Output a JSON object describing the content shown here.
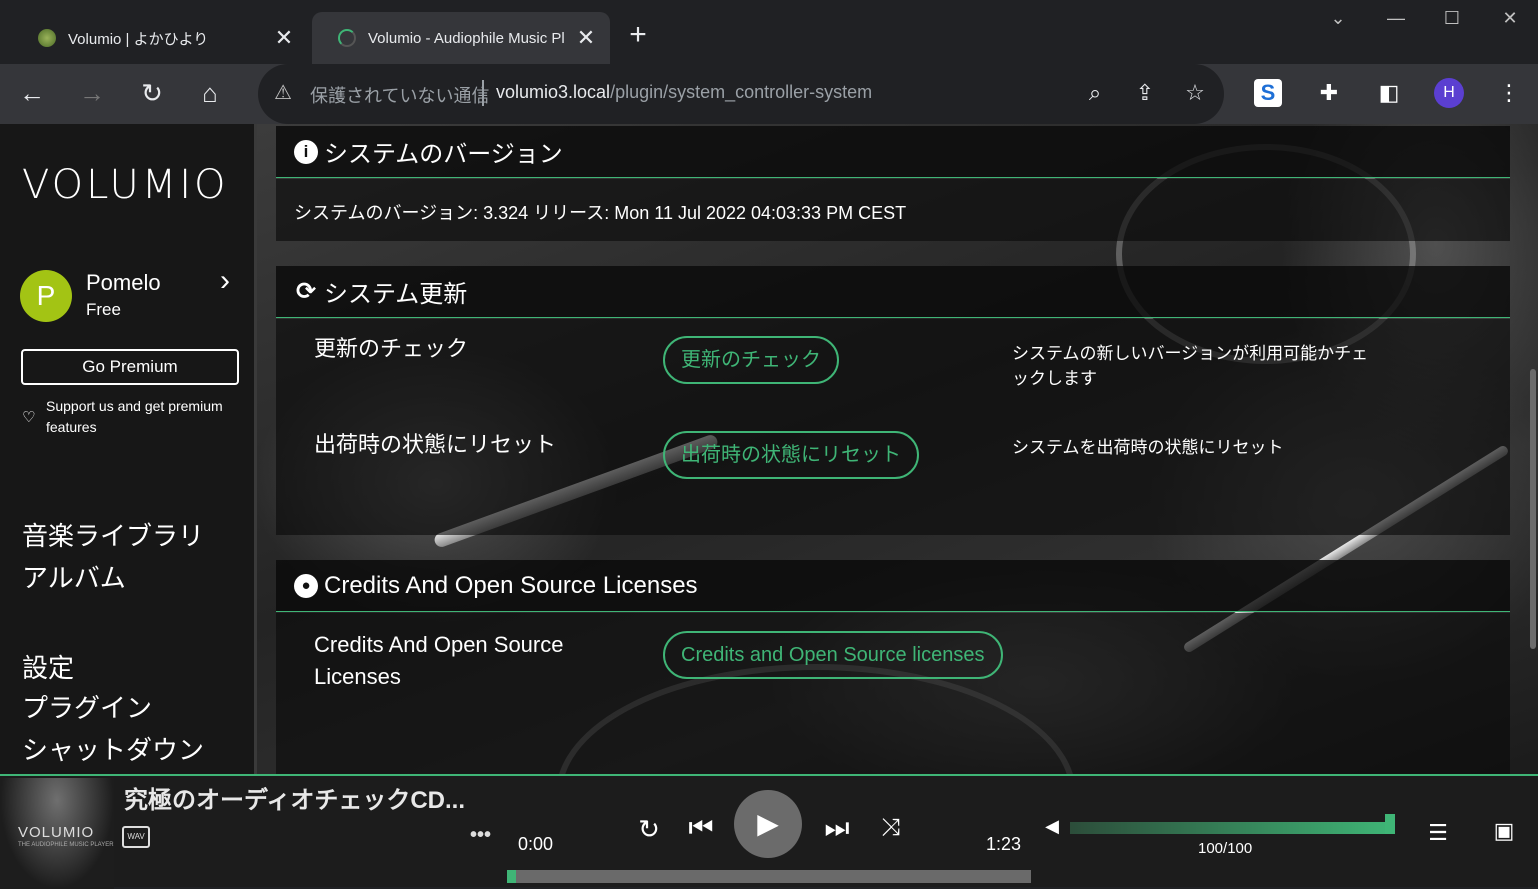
{
  "browser": {
    "tabs": [
      {
        "title": "Volumio | よかひより",
        "active": false
      },
      {
        "title": "Volumio - Audiophile Music Pl",
        "active": true
      }
    ],
    "address": {
      "security_text": "保護されていない通信",
      "host": "volumio3.local",
      "path": "/plugin/system_controller-system"
    },
    "profile_initial": "H"
  },
  "sidebar": {
    "logo": "VOLUMIO",
    "user": {
      "initial": "P",
      "name": "Pomelo",
      "plan": "Free"
    },
    "go_premium": "Go Premium",
    "support_text": "Support us and get premium features",
    "menu_primary": [
      "音楽ライブラリ",
      "アルバム"
    ],
    "menu_secondary": [
      "設定",
      "プラグイン",
      "シャットダウン"
    ]
  },
  "sections": {
    "version": {
      "title": "システムのバージョン",
      "text": "システムのバージョン: 3.324 リリース: Mon 11 Jul 2022 04:03:33 PM CEST"
    },
    "update": {
      "title": "システム更新",
      "rows": [
        {
          "label": "更新のチェック",
          "button": "更新のチェック",
          "description": "システムの新しいバージョンが利用可能かチェックします"
        },
        {
          "label": "出荷時の状態にリセット",
          "button": "出荷時の状態にリセット",
          "description": "システムを出荷時の状態にリセット"
        }
      ]
    },
    "credits": {
      "title": "Credits And Open Source Licenses",
      "label": "Credits And Open Source Licenses",
      "button": "Credits and Open Source licenses"
    }
  },
  "player": {
    "album_art_text": "VOLUMIO",
    "album_art_subtext": "THE AUDIOPHILE MUSIC PLAYER",
    "track_title": "究極のオーディオチェックCD...",
    "format": "WAV",
    "more": "•••",
    "elapsed": "0:00",
    "duration": "1:23",
    "progress_fraction": 0.0,
    "volume_text": "100/100",
    "volume_level": 1.0
  },
  "colors": {
    "accent": "#3fb576",
    "avatar": "#a3c414",
    "sidebar": "#171717"
  }
}
